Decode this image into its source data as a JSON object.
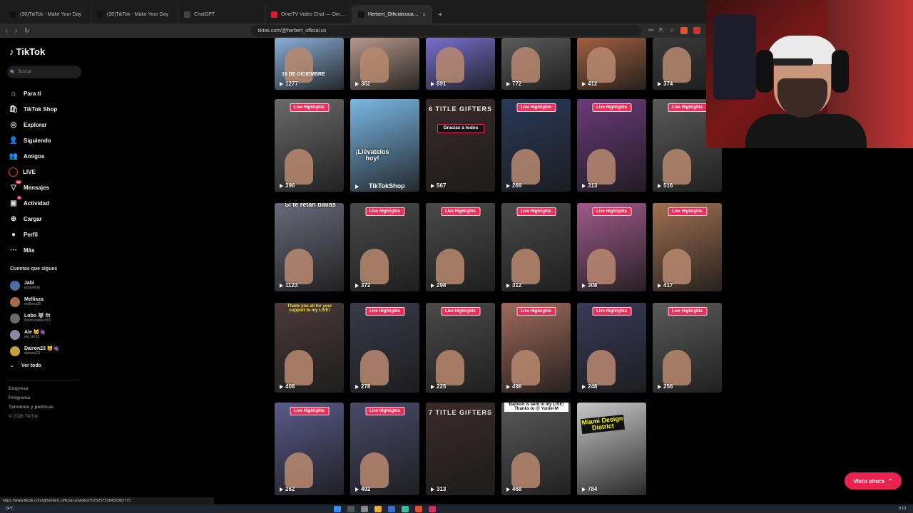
{
  "tabs": [
    {
      "title": "(30)TikTok - Make Your Day",
      "color": "#111"
    },
    {
      "title": "(30)TikTok - Make Your Day",
      "color": "#111"
    },
    {
      "title": "ChatGPT",
      "color": "#444"
    },
    {
      "title": "OmeTV Video Chat — Omegle Rand",
      "color": "#c23"
    },
    {
      "title": "Herbert_Officialcuua (@herbert",
      "color": "#111",
      "active": true
    }
  ],
  "address": {
    "url": "tiktok.com/@herbert_official.us"
  },
  "brand": {
    "name": "TikTok"
  },
  "search": {
    "placeholder": "Buscar"
  },
  "nav": [
    {
      "label": "Para ti",
      "icon": "home-icon",
      "glyph": "⌂"
    },
    {
      "label": "TikTok Shop",
      "icon": "shop-icon",
      "glyph": "🛍"
    },
    {
      "label": "Explorar",
      "icon": "compass-icon",
      "glyph": "◎"
    },
    {
      "label": "Siguiendo",
      "icon": "following-icon",
      "glyph": "👤"
    },
    {
      "label": "Amigos",
      "icon": "friends-icon",
      "glyph": "👥"
    },
    {
      "label": "LIVE",
      "icon": "live-icon",
      "glyph": "LIVE"
    },
    {
      "label": "Mensajes",
      "icon": "messages-icon",
      "glyph": "▽",
      "badge": "23"
    },
    {
      "label": "Actividad",
      "icon": "activity-icon",
      "glyph": "▣",
      "badge": "9"
    },
    {
      "label": "Cargar",
      "icon": "upload-icon",
      "glyph": "⊕"
    },
    {
      "label": "Perfil",
      "icon": "profile-icon",
      "glyph": "●"
    },
    {
      "label": "Más",
      "icon": "more-icon",
      "glyph": "···"
    }
  ],
  "following": {
    "title": "Cuentas que sigues",
    "accounts": [
      {
        "name": "Jabi",
        "handle": "javvviwrld"
      },
      {
        "name": "Mellisza",
        "handle": "mellisza25"
      },
      {
        "name": "Lobo 🐺 flt",
        "handle": "losintocables065"
      },
      {
        "name": "Ale 🐱🍇",
        "handle": "ale_brr32"
      },
      {
        "name": "Dairon23 🐱🍇",
        "handle": "dairona23"
      }
    ],
    "see_all": "Ver todo"
  },
  "footer": [
    "Empresa",
    "Programa",
    "Términos y políticas",
    "© 2026 TikTok"
  ],
  "videos": [
    {
      "views": "1277",
      "bg": "#8ab0d9",
      "top": "16 DE DICIEMBRE"
    },
    {
      "views": "362",
      "bg": "#b8998c"
    },
    {
      "views": "891",
      "bg": "#7a6fd0"
    },
    {
      "views": "772",
      "bg": "#5b5b5b"
    },
    {
      "views": "412",
      "bg": "#a06040"
    },
    {
      "views": "374",
      "bg": "#3a3a3a"
    },
    {
      "views": "396",
      "bg": "#6a6a6a",
      "lh": "Live Highlights"
    },
    {
      "views": "",
      "bg": "#7ab8e6",
      "text": "¡Llévatelos hoy!",
      "brand": "TikTokShop"
    },
    {
      "views": "567",
      "bg": "#3a2a2a",
      "text": "6 TITLE GIFTERS",
      "sub": "Gracias a todos"
    },
    {
      "views": "269",
      "bg": "#2a3a5a",
      "lh": "Live Highlights"
    },
    {
      "views": "313",
      "bg": "#6a3a7a",
      "lh": "Live Highlights"
    },
    {
      "views": "516",
      "bg": "#5a5a5a",
      "lh": "Live Highlights"
    },
    {
      "views": "1123",
      "bg": "#6a6a7a",
      "text": "Si te retan bailas"
    },
    {
      "views": "372",
      "bg": "#4a4a4a",
      "lh": "Live Highlights"
    },
    {
      "views": "298",
      "bg": "#4a4a4a",
      "lh": "Live Highlights"
    },
    {
      "views": "312",
      "bg": "#4a4a4a",
      "lh": "Live Highlights"
    },
    {
      "views": "308",
      "bg": "#a05a8a",
      "lh": "Live Highlights"
    },
    {
      "views": "417",
      "bg": "#a07050",
      "lh": "Live Highlights"
    },
    {
      "views": "408",
      "bg": "#4a3a3a",
      "text": "Thank you all for your support to my LIVE!"
    },
    {
      "views": "278",
      "bg": "#3a3a4a",
      "lh": "Live Highlights"
    },
    {
      "views": "225",
      "bg": "#4a4a4a",
      "lh": "Live Highlights"
    },
    {
      "views": "498",
      "bg": "#a06a5a",
      "lh": "Live Highlights"
    },
    {
      "views": "248",
      "bg": "#3a3a5a",
      "lh": "Live Highlights"
    },
    {
      "views": "256",
      "bg": "#5a5a5a",
      "lh": "Live Highlights"
    },
    {
      "views": "262",
      "bg": "#5a5a8a",
      "lh": "Live Highlights"
    },
    {
      "views": "492",
      "bg": "#4a4a6a",
      "lh": "Live Highlights"
    },
    {
      "views": "313",
      "bg": "#3a2a2a",
      "text": "7 TITLE GIFTERS"
    },
    {
      "views": "468",
      "bg": "#5a5a5a",
      "text": "Balloon is sent in my LIVE! Thanks to @ Yuniel M"
    },
    {
      "views": "784",
      "bg": "#c8c8c8",
      "text": "Miami Design District"
    }
  ],
  "visto": {
    "label": "Visto ahora"
  },
  "status_url": "https://www.tiktok.com/@herbert_official.us/video/7575257518432062775",
  "taskbar": {
    "weather": "24°C",
    "clock": "0:13"
  }
}
